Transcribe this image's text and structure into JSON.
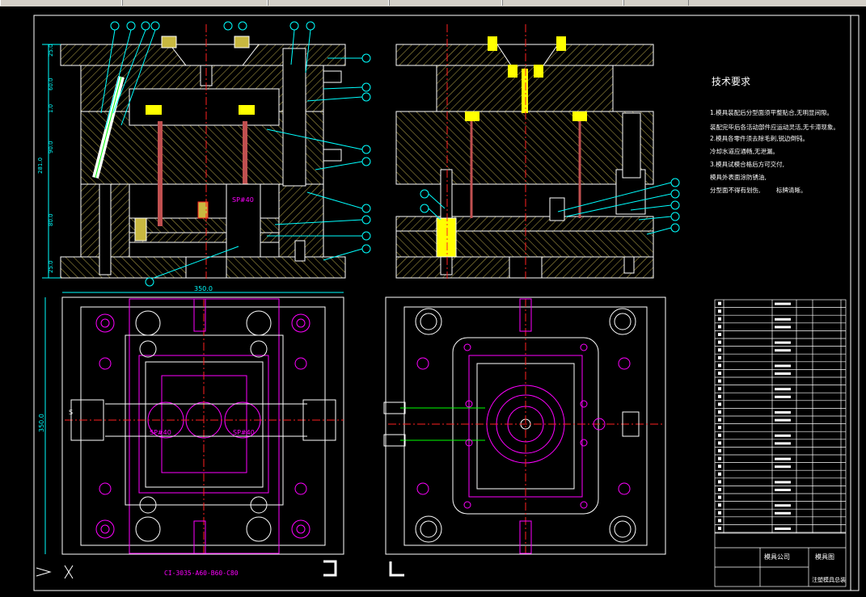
{
  "toolbar": {
    "tabs": [
      "",
      "",
      "",
      "",
      "",
      ""
    ]
  },
  "technical_requirements": {
    "title": "技术要求",
    "lines": [
      "1.模具装配后分型面须平整贴合,无明显间隙。",
      "装配完毕后各活动部件应运动灵活,无卡滞现象。",
      "2.模具各零件须去除毛刺,锐边倒钝。",
      "冷却水道应通畅,无泄漏。",
      "3.模具试模合格后方可交付,",
      "模具外表面涂防锈油,",
      "分型面不得有划伤,",
      "标牌清晰。"
    ]
  },
  "labels": {
    "sp_top": "SP#40",
    "sp_left": "SP#40",
    "sp_right": "SP#40",
    "plan_width": "350.0",
    "plan_height": "350.0",
    "mold_base": "CI-3035-A60-B60-C80",
    "hole_s": "S"
  },
  "dimensions_left": [
    "25.0",
    "60.0",
    "1.0",
    "90.0",
    "80.0",
    "25.0",
    "281.0"
  ],
  "colors": {
    "background": "#000000",
    "outline": "#ffffff",
    "hatch": "#b8a84a",
    "magenta": "#ff00ff",
    "cyan": "#00ffff",
    "red": "#ff2020",
    "yellow": "#ffff00",
    "green": "#00ff00",
    "blue": "#4070ff"
  },
  "title_block": {
    "company": "模具公司",
    "drawing_name": "模具图",
    "drawing_code": "注塑模具总装"
  }
}
